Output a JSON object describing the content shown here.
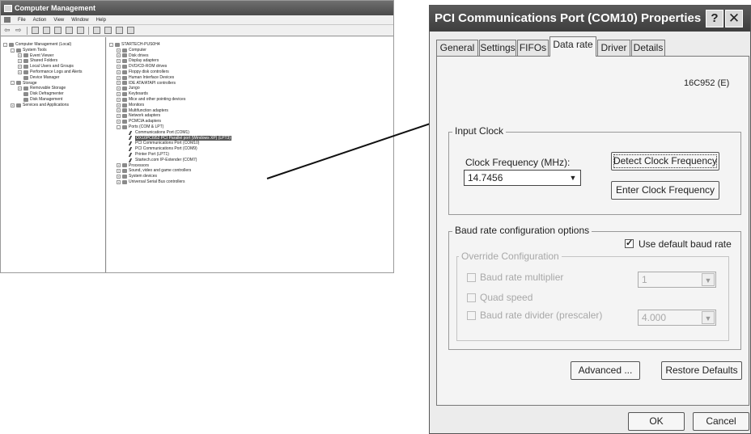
{
  "computer_management": {
    "title": "Computer Management",
    "menu": [
      "File",
      "Action",
      "View",
      "Window",
      "Help"
    ],
    "left_tree": [
      {
        "label": "Computer Management (Local)",
        "level": 0,
        "exp": "-"
      },
      {
        "label": "System Tools",
        "level": 1,
        "exp": "-"
      },
      {
        "label": "Event Viewer",
        "level": 2,
        "exp": "+"
      },
      {
        "label": "Shared Folders",
        "level": 2,
        "exp": "+"
      },
      {
        "label": "Local Users and Groups",
        "level": 2,
        "exp": "+"
      },
      {
        "label": "Performance Logs and Alerts",
        "level": 2,
        "exp": "+"
      },
      {
        "label": "Device Manager",
        "level": 2,
        "exp": ""
      },
      {
        "label": "Storage",
        "level": 1,
        "exp": "-"
      },
      {
        "label": "Removable Storage",
        "level": 2,
        "exp": "+"
      },
      {
        "label": "Disk Defragmenter",
        "level": 2,
        "exp": ""
      },
      {
        "label": "Disk Management",
        "level": 2,
        "exp": ""
      },
      {
        "label": "Services and Applications",
        "level": 1,
        "exp": "+"
      }
    ],
    "right_tree": [
      {
        "label": "STARTECH-PUS0H4",
        "level": 0,
        "exp": "-"
      },
      {
        "label": "Computer",
        "level": 1,
        "exp": "+"
      },
      {
        "label": "Disk drives",
        "level": 1,
        "exp": "+"
      },
      {
        "label": "Display adapters",
        "level": 1,
        "exp": "+"
      },
      {
        "label": "DVD/CD-ROM drives",
        "level": 1,
        "exp": "+"
      },
      {
        "label": "Floppy disk controllers",
        "level": 1,
        "exp": "+"
      },
      {
        "label": "Human Interface Devices",
        "level": 1,
        "exp": "+"
      },
      {
        "label": "IDE ATA/ATAPI controllers",
        "level": 1,
        "exp": "+"
      },
      {
        "label": "Jungo",
        "level": 1,
        "exp": "+"
      },
      {
        "label": "Keyboards",
        "level": 1,
        "exp": "+"
      },
      {
        "label": "Mice and other pointing devices",
        "level": 1,
        "exp": "+"
      },
      {
        "label": "Monitors",
        "level": 1,
        "exp": "+"
      },
      {
        "label": "Multifunction adapters",
        "level": 1,
        "exp": "+"
      },
      {
        "label": "Network adapters",
        "level": 1,
        "exp": "+"
      },
      {
        "label": "PCMCIA adapters",
        "level": 1,
        "exp": "+"
      },
      {
        "label": "Ports (COM & LPT)",
        "level": 1,
        "exp": "-"
      },
      {
        "label": "Communications Port (COM1)",
        "level": 2,
        "exp": ""
      },
      {
        "label": "OX16PCI952 PCI Parallel port (Windows XP) (LPT3)",
        "level": 2,
        "exp": "",
        "selected": true
      },
      {
        "label": "PCI Communications Port (COM10)",
        "level": 2,
        "exp": ""
      },
      {
        "label": "PCI Communications Port (COM9)",
        "level": 2,
        "exp": ""
      },
      {
        "label": "Printer Port (LPT1)",
        "level": 2,
        "exp": ""
      },
      {
        "label": "Startech.com IP-Extender (COM7)",
        "level": 2,
        "exp": ""
      },
      {
        "label": "Processors",
        "level": 1,
        "exp": "+"
      },
      {
        "label": "Sound, video and game controllers",
        "level": 1,
        "exp": "+"
      },
      {
        "label": "System devices",
        "level": 1,
        "exp": "+"
      },
      {
        "label": "Universal Serial Bus controllers",
        "level": 1,
        "exp": "+"
      }
    ]
  },
  "dialog": {
    "title": "PCI Communications Port (COM10) Properties",
    "help_glyph": "?",
    "close_glyph": "✕",
    "tabs": [
      "General",
      "Settings",
      "FIFOs",
      "Data rate",
      "Driver",
      "Details"
    ],
    "active_tab": "Data rate",
    "chip": "16C952 (E)",
    "input_clock": {
      "caption": "Input Clock",
      "freq_label": "Clock Frequency (MHz):",
      "freq_value": "14.7456",
      "detect_button": "Detect Clock Frequency",
      "enter_button": "Enter Clock Frequency"
    },
    "baud": {
      "caption": "Baud rate configuration options",
      "use_default_label": "Use default baud rate",
      "use_default_checked": true,
      "override_caption": "Override Configuration",
      "multiplier_label": "Baud rate multiplier",
      "multiplier_value": "1",
      "quad_label": "Quad speed",
      "divider_label": "Baud rate divider (prescaler)",
      "divider_value": "4.000"
    },
    "buttons": {
      "advanced": "Advanced ...",
      "restore": "Restore Defaults",
      "ok": "OK",
      "cancel": "Cancel"
    }
  }
}
